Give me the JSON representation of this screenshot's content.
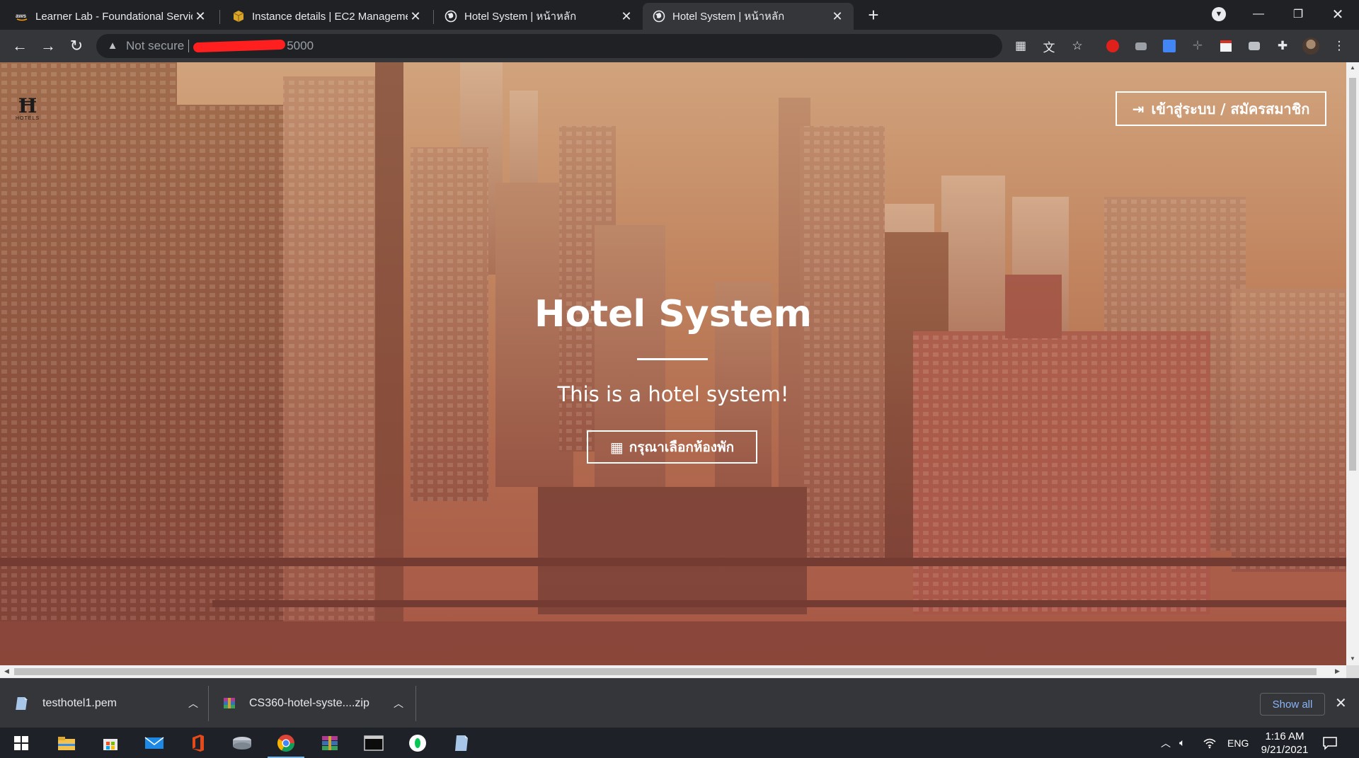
{
  "browser": {
    "tabs": [
      {
        "title": "Learner Lab - Foundational Servic",
        "favicon": "aws-icon",
        "active": false
      },
      {
        "title": "Instance details | EC2 Manageme",
        "favicon": "ec2-box-icon",
        "active": false
      },
      {
        "title": "Hotel System | หน้าหลัก",
        "favicon": "globe-icon",
        "active": false
      },
      {
        "title": "Hotel System | หน้าหลัก",
        "favicon": "globe-icon",
        "active": true
      }
    ],
    "address_bar": {
      "security_label": "Not secure",
      "url_visible_tail": "5000"
    }
  },
  "page": {
    "login_button_label": "เข้าสู่ระบบ / สมัครสมาชิก",
    "logo_text": "HOTELS",
    "hero_title": "Hotel System",
    "hero_subtitle": "This is a hotel system!",
    "choose_room_label": "กรุณาเลือกห้องพัก"
  },
  "downloads": {
    "items": [
      {
        "filename": "testhotel1.pem"
      },
      {
        "filename": "CS360-hotel-syste....zip"
      }
    ],
    "show_all_label": "Show all"
  },
  "taskbar": {
    "language": "ENG",
    "time": "1:16 AM",
    "date": "9/21/2021"
  },
  "colors": {
    "accent_link": "#8ab4f8",
    "hero_top": "#cfa37e",
    "hero_bottom": "#a45a45"
  }
}
